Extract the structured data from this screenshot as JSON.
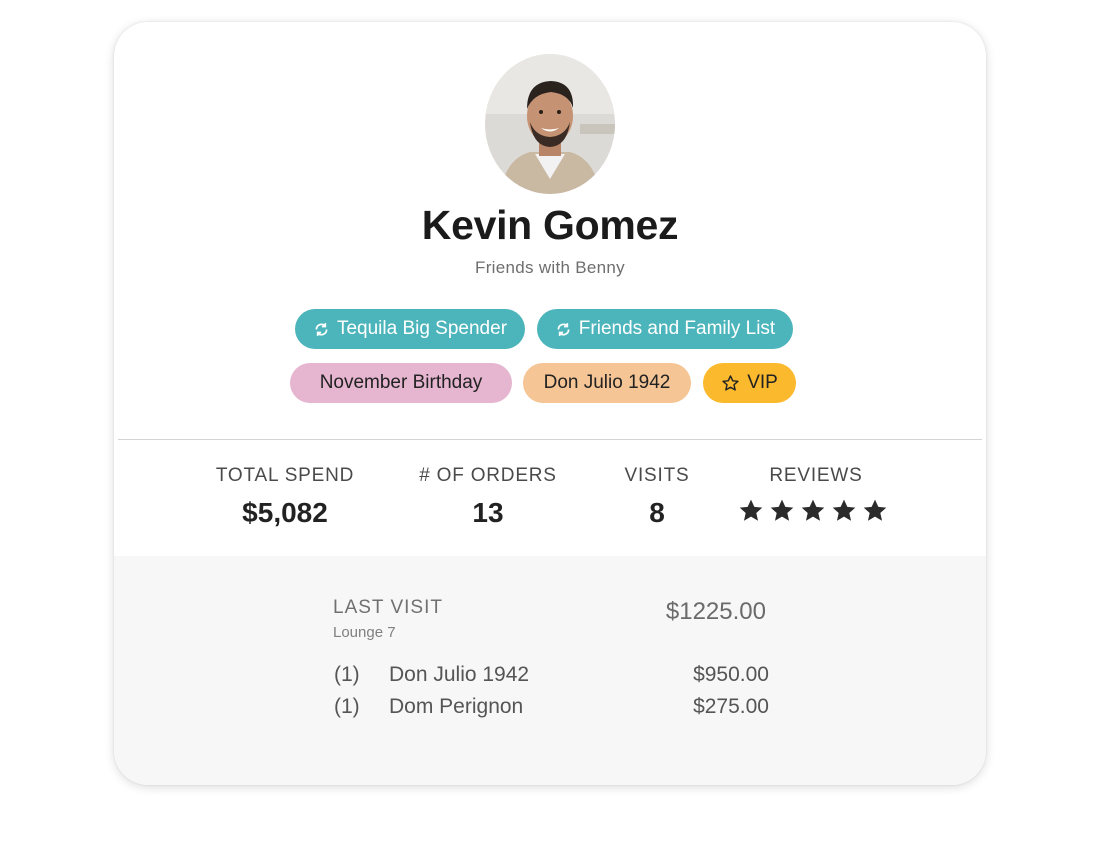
{
  "profile": {
    "name": "Kevin Gomez",
    "subtitle": "Friends with Benny",
    "avatar_icon": "person-photo"
  },
  "tags": {
    "tequila_big_spender": "Tequila Big Spender",
    "friends_and_family": "Friends and Family List",
    "november_birthday": "November Birthday",
    "don_julio": "Don Julio 1942",
    "vip": "VIP",
    "sync_icon": "sync-icon",
    "star_outline_icon": "star-outline-icon"
  },
  "colors": {
    "teal": "#4cb5bb",
    "pink": "#e6b6d0",
    "orange": "#f5c595",
    "yellow": "#fbb92d",
    "star": "#2b2b2b"
  },
  "stats": {
    "total_spend_label": "TOTAL SPEND",
    "total_spend_value": "$5,082",
    "orders_label": "# OF ORDERS",
    "orders_value": "13",
    "visits_label": "VISITS",
    "visits_value": "8",
    "reviews_label": "REVIEWS",
    "reviews_rating": 5,
    "reviews_max": 5
  },
  "last_visit": {
    "label": "LAST VISIT",
    "location": "Lounge 7",
    "total": "$1225.00",
    "items": [
      {
        "qty": "(1)",
        "name": "Don Julio 1942",
        "price": "$950.00"
      },
      {
        "qty": "(1)",
        "name": "Dom Perignon",
        "price": "$275.00"
      }
    ]
  }
}
